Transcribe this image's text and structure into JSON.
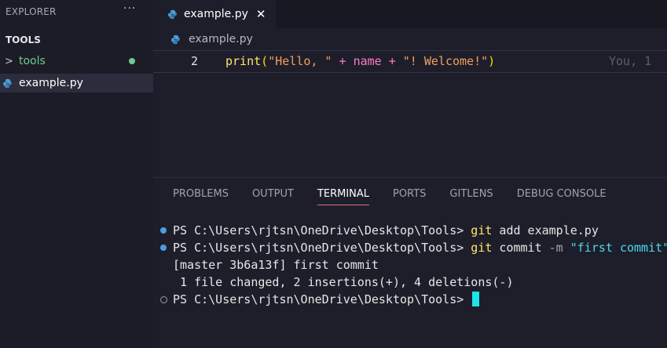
{
  "explorer": {
    "title": "EXPLORER",
    "more": "···",
    "section": "TOOLS",
    "items": [
      {
        "label": "tools",
        "type": "folder"
      },
      {
        "label": "example.py",
        "type": "file"
      }
    ]
  },
  "editor": {
    "tab": {
      "label": "example.py",
      "close": "✕"
    },
    "breadcrumb": "example.py",
    "line": {
      "number": "2",
      "tokens": {
        "fn": "print",
        "p1": "(",
        "s1": "\"Hello, \"",
        "o1": " + ",
        "v1": "name",
        "o2": " + ",
        "s2": "\"! Welcome!\"",
        "p2": ")"
      },
      "blame": "You, 1"
    }
  },
  "panel": {
    "tabs": [
      "PROBLEMS",
      "OUTPUT",
      "TERMINAL",
      "PORTS",
      "GITLENS",
      "DEBUG CONSOLE"
    ],
    "active_tab": "TERMINAL"
  },
  "terminal": {
    "prompt": "PS C:\\Users\\rjtsn\\OneDrive\\Desktop\\Tools> ",
    "cmd1": {
      "git": "git",
      "rest": " add example.py"
    },
    "cmd2": {
      "git": "git",
      "rest": " commit ",
      "flag": "-m",
      "msg": " \"first commit\""
    },
    "out1": "[master 3b6a13f] first commit",
    "out2": " 1 file changed, 2 insertions(+), 4 deletions(-)"
  },
  "colors": {
    "folder": "#73c991",
    "accent": "#1ee3e8",
    "terminal_bg": "#1e1e2b"
  }
}
